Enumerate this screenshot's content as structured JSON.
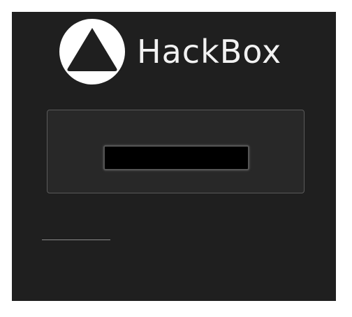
{
  "header": {
    "brand_name": "HackBox",
    "logo_icon": "triangle-in-circle-icon"
  },
  "login": {
    "input_value": "",
    "input_placeholder": ""
  },
  "colors": {
    "background": "#1f1f1f",
    "card": "#282828",
    "card_border": "#5a5a5a",
    "input_bg": "#000000",
    "text": "#f2f2f2"
  }
}
